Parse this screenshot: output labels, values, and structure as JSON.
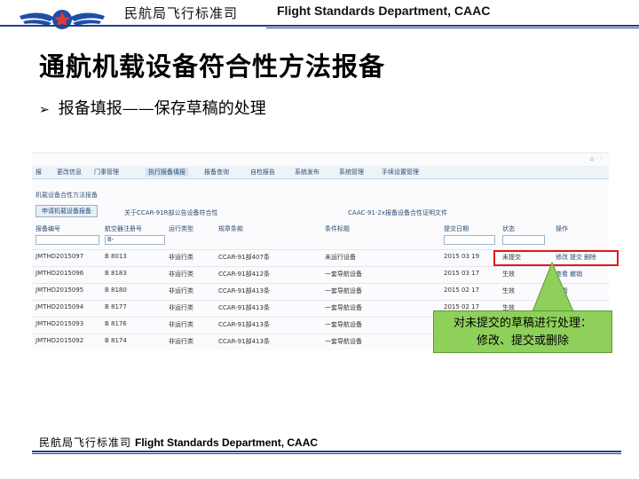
{
  "header": {
    "cn": "民航局飞行标准司",
    "en": "Flight Standards Department, CAAC"
  },
  "title": "通航机载设备符合性方法报备",
  "bullet": "报备填报——保存草稿的处理",
  "screenshot": {
    "nav": [
      "报",
      "更改信息",
      "门事管理",
      "执行报备填报",
      "报备查询",
      "自检报告",
      "系统发布",
      "系统管理",
      "手续设置管理"
    ],
    "breadcrumb": "机载设备合性方法报备",
    "buttons": [
      "申请机载设备报备"
    ],
    "top_links": [
      "关于CCAR-91R部公告设备符合性",
      "CAAC-91-2x报备设备合性证明文件"
    ],
    "headers": [
      "报备编号",
      "航空器注册号",
      "运行类型",
      "规章条款",
      "条件标题",
      "提交日期",
      "状态",
      "操作"
    ],
    "filter_value": "B-",
    "rows": [
      {
        "id": "JMTHD2015097",
        "reg": "B 8013",
        "type": "非运行类",
        "rule": "CCAR-91部407条",
        "item": "未运行设备",
        "date": "2015 03 19",
        "status": "未提交",
        "actions": [
          "修改",
          "提交",
          "删除"
        ]
      },
      {
        "id": "JMTHD2015096",
        "reg": "B 8183",
        "type": "非运行类",
        "rule": "CCAR-91部412条",
        "item": "一套导航设备",
        "date": "2015 03 17",
        "status": "生效",
        "actions": [
          "查看",
          "撤销"
        ]
      },
      {
        "id": "JMTHD2015095",
        "reg": "B 8180",
        "type": "非运行类",
        "rule": "CCAR-91部413条",
        "item": "一套导航设备",
        "date": "2015 02 17",
        "status": "生效",
        "actions": [
          "查看"
        ]
      },
      {
        "id": "JMTHD2015094",
        "reg": "B 8177",
        "type": "非运行类",
        "rule": "CCAR-91部413条",
        "item": "一套导航设备",
        "date": "2015 02 17",
        "status": "生效",
        "actions": [
          "查看"
        ]
      },
      {
        "id": "JMTHD2015093",
        "reg": "B 8176",
        "type": "非运行类",
        "rule": "CCAR-91部413条",
        "item": "一套导航设备",
        "date": "",
        "status": "",
        "actions": []
      },
      {
        "id": "JMTHD2015092",
        "reg": "B 8174",
        "type": "非运行类",
        "rule": "CCAR-91部413条",
        "item": "一套导航设备",
        "date": "",
        "status": "",
        "actions": []
      }
    ]
  },
  "callout": {
    "line1": "对未提交的草稿进行处理：",
    "line2": "修改、提交或删除"
  },
  "footer": {
    "cn": "民航局飞行标准司",
    "en": "Flight Standards Department, CAAC"
  },
  "colors": {
    "rule": "#1f3d8c",
    "highlight": "#e01b1b",
    "callout_bg": "#8fd05a"
  }
}
